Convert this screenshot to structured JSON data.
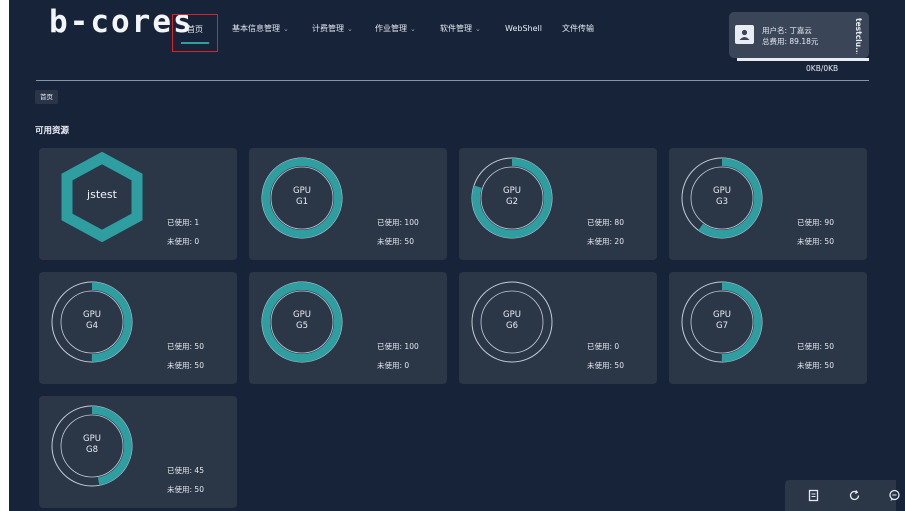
{
  "app": {
    "logo": "b-cores"
  },
  "nav": {
    "items": [
      {
        "label": "首页",
        "has_dropdown": false,
        "active": true
      },
      {
        "label": "基本信息管理",
        "has_dropdown": true
      },
      {
        "label": "计费管理",
        "has_dropdown": true
      },
      {
        "label": "作业管理",
        "has_dropdown": true
      },
      {
        "label": "软件管理",
        "has_dropdown": true
      },
      {
        "label": "WebShell",
        "has_dropdown": false
      },
      {
        "label": "文件传输",
        "has_dropdown": false
      }
    ],
    "chevron": "⌄"
  },
  "user": {
    "username_line": "用户名: 丁嘉云",
    "cost_line": "总费用: 89.18元",
    "side_text": "testclu...",
    "traffic": "0KB/0KB"
  },
  "breadcrumb": {
    "label": "首页"
  },
  "section": {
    "title": "可用资源"
  },
  "labels": {
    "used": "已使用:",
    "unused": "未使用:",
    "gpu": "GPU"
  },
  "cluster": {
    "name": "jstest",
    "used": "1",
    "unused": "0"
  },
  "gpus": [
    {
      "name": "G1",
      "used": "100",
      "unused": "50",
      "fraction": 1.0
    },
    {
      "name": "G2",
      "used": "80",
      "unused": "20",
      "fraction": 0.8
    },
    {
      "name": "G3",
      "used": "90",
      "unused": "50",
      "fraction": 0.6
    },
    {
      "name": "G4",
      "used": "50",
      "unused": "50",
      "fraction": 0.5
    },
    {
      "name": "G5",
      "used": "100",
      "unused": "0",
      "fraction": 1.0
    },
    {
      "name": "G6",
      "used": "0",
      "unused": "50",
      "fraction": 0.0
    },
    {
      "name": "G7",
      "used": "50",
      "unused": "50",
      "fraction": 0.5
    },
    {
      "name": "G8",
      "used": "45",
      "unused": "50",
      "fraction": 0.47
    }
  ],
  "colors": {
    "accent": "#2f9ea0",
    "background": "#172339",
    "card": "#2b3647",
    "active_border": "#d7232d"
  },
  "toolbar": {
    "icons": [
      "document-icon",
      "refresh-icon",
      "chat-icon"
    ]
  }
}
